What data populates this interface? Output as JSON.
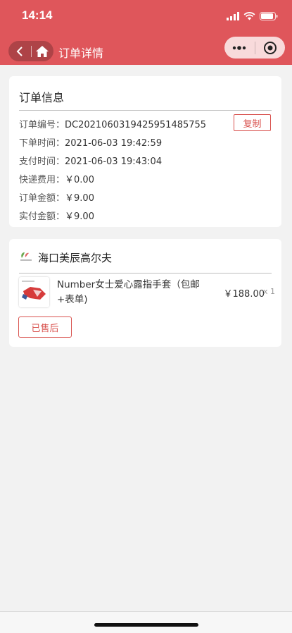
{
  "status_bar": {
    "time": "14:14"
  },
  "nav": {
    "title": "订单详情"
  },
  "order_info": {
    "title": "订单信息",
    "copy_label": "复制",
    "rows": [
      {
        "label": "订单编号：",
        "value": "DC202106031942595148575​5"
      },
      {
        "label": "下单时间：",
        "value": "2021-06-03 19:42:59"
      },
      {
        "label": "支付时间：",
        "value": "2021-06-03 19:43:04"
      },
      {
        "label": "快递费用：",
        "value": "￥0.00"
      },
      {
        "label": "订单金额：",
        "value": "￥9.00"
      },
      {
        "label": "实付金额：",
        "value": "￥9.00"
      }
    ]
  },
  "shop": {
    "name": "海口美辰高尔夫",
    "product": {
      "name": "Number女士爱心露指手套（包邮+表单)",
      "price": "￥188.00",
      "qty": "x 1"
    },
    "aftersale_label": "已售后"
  },
  "colors": {
    "accent": "#df565b",
    "button_border": "#d9534f"
  }
}
